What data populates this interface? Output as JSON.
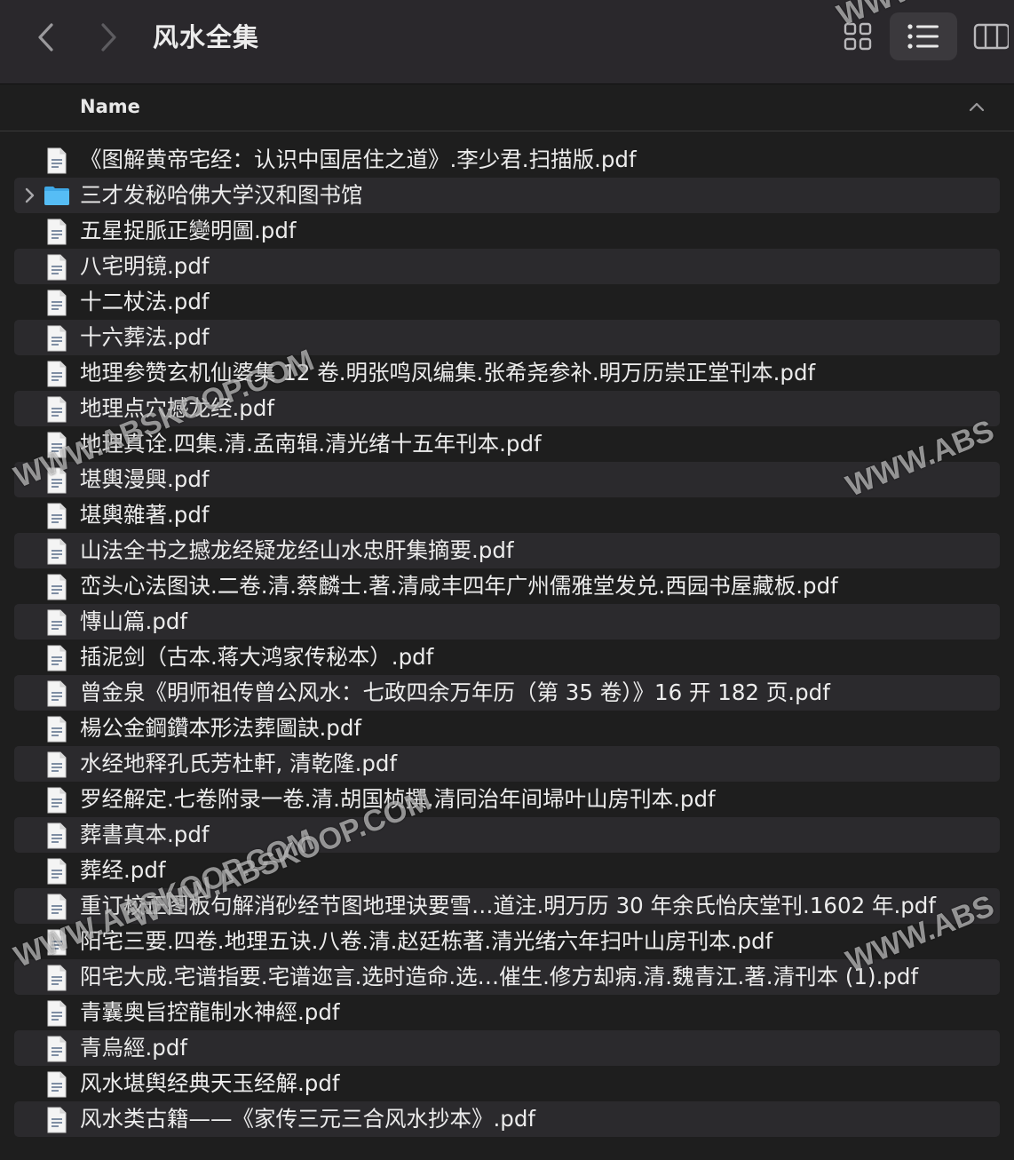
{
  "toolbar": {
    "title": "风水全集",
    "icons": {
      "back": "chevron-left-icon",
      "forward": "chevron-right-icon",
      "icon_view": "grid-view-icon",
      "list_view": "list-view-icon",
      "column_view": "column-view-icon"
    }
  },
  "header": {
    "name_label": "Name",
    "sort": "ascending"
  },
  "files": [
    {
      "name": "《图解黄帝宅经：认识中国居住之道》.李少君.扫描版.pdf",
      "kind": "pdf"
    },
    {
      "name": "三才发秘哈佛大学汉和图书馆",
      "kind": "folder"
    },
    {
      "name": "五星捉脈正變明圖.pdf",
      "kind": "pdf"
    },
    {
      "name": "八宅明镜.pdf",
      "kind": "pdf"
    },
    {
      "name": "十二杖法.pdf",
      "kind": "pdf"
    },
    {
      "name": "十六葬法.pdf",
      "kind": "pdf"
    },
    {
      "name": "地理参赞玄机仙婆集 12 卷.明张鸣凤编集.张希尧参补.明万历崇正堂刊本.pdf",
      "kind": "pdf"
    },
    {
      "name": "地理点穴撼龙经.pdf",
      "kind": "pdf"
    },
    {
      "name": "地理真诠.四集.清.孟南辑.清光绪十五年刊本.pdf",
      "kind": "pdf"
    },
    {
      "name": "堪輿漫興.pdf",
      "kind": "pdf"
    },
    {
      "name": "堪輿雜著.pdf",
      "kind": "pdf"
    },
    {
      "name": "山法全书之撼龙经疑龙经山水忠肝集摘要.pdf",
      "kind": "pdf"
    },
    {
      "name": "峦头心法图诀.二卷.清.蔡麟士.著.清咸丰四年广州儒雅堂发兑.西园书屋藏板.pdf",
      "kind": "pdf"
    },
    {
      "name": "慱山篇.pdf",
      "kind": "pdf"
    },
    {
      "name": "插泥剑（古本.蒋大鸿家传秘本）.pdf",
      "kind": "pdf"
    },
    {
      "name": "曾金泉《明师祖传曾公风水：七政四余万年历（第 35 卷）》16 开 182 页.pdf",
      "kind": "pdf"
    },
    {
      "name": "楊公金鋼鑽本形法葬圖訣.pdf",
      "kind": "pdf"
    },
    {
      "name": "水经地释孔氏芳杜軒, 清乾隆.pdf",
      "kind": "pdf"
    },
    {
      "name": "罗经解定.七卷附录一卷.清.胡国桢撰.清同治年间埽叶山房刊本.pdf",
      "kind": "pdf"
    },
    {
      "name": "葬書真本.pdf",
      "kind": "pdf"
    },
    {
      "name": "葬经.pdf",
      "kind": "pdf"
    },
    {
      "name": "重订校正图板句解消砂经节图地理诀要雪…道注.明万历 30 年余氏怡庆堂刊.1602 年.pdf",
      "kind": "pdf"
    },
    {
      "name": "阳宅三要.四卷.地理五诀.八卷.清.赵廷栋著.清光绪六年扫叶山房刊本.pdf",
      "kind": "pdf"
    },
    {
      "name": "阳宅大成.宅谱指要.宅谱迩言.选时造命.选…催生.修方却病.清.魏青江.著.清刊本 (1).pdf",
      "kind": "pdf"
    },
    {
      "name": "青囊奥旨控龍制水神經.pdf",
      "kind": "pdf"
    },
    {
      "name": "青烏經.pdf",
      "kind": "pdf"
    },
    {
      "name": "风水堪舆经典天玉经解.pdf",
      "kind": "pdf"
    },
    {
      "name": "风水类古籍——《家传三元三合风水抄本》.pdf",
      "kind": "pdf"
    }
  ],
  "watermarks": [
    "WWW.ABSKOOP.COM",
    "WWW.ABS",
    "WWW.ABSKOOP.COM",
    "WWW.ABS",
    "WWW.ABSKOOP.COM",
    "WWW.ABS"
  ]
}
